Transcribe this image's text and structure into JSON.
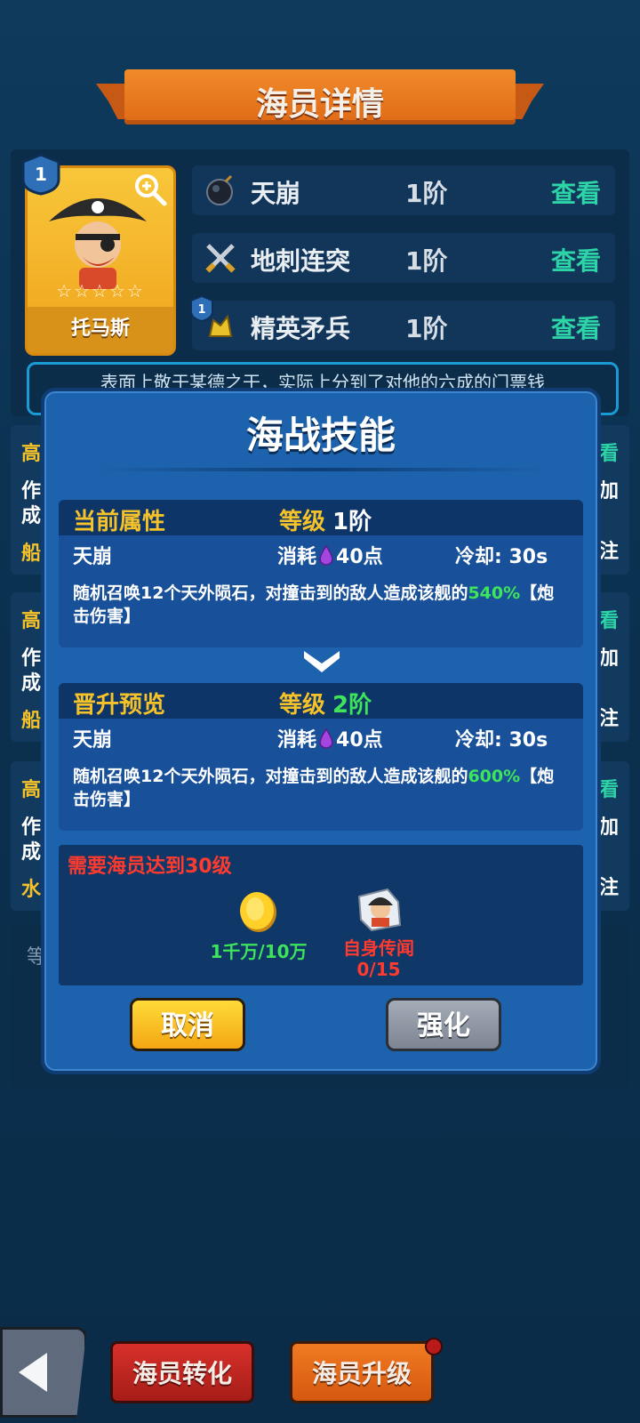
{
  "header": {
    "title": "海员详情"
  },
  "hero": {
    "level": "1",
    "name": "托马斯",
    "stars": "☆☆☆☆☆",
    "description": "表面上敬于某德之干，实际上分到了对他的六成的门票钱"
  },
  "skills": [
    {
      "name": "天崩",
      "level": "1阶",
      "action": "查看",
      "icon": "bomb-icon"
    },
    {
      "name": "地刺连突",
      "level": "1阶",
      "action": "查看",
      "icon": "crossed-swords-icon"
    },
    {
      "name": "精英矛兵",
      "level": "1阶",
      "action": "查看",
      "icon": "soldier-icon",
      "badge": "1"
    }
  ],
  "background_rows": [
    {
      "left1": "高",
      "left2": "作",
      "left3": "成",
      "left4": "船",
      "right1": "看",
      "right2": "加",
      "right3": "注"
    },
    {
      "left1": "高",
      "left2": "作",
      "left3": "成",
      "left4": "船",
      "right1": "看",
      "right2": "加",
      "right3": "注"
    },
    {
      "left1": "高",
      "left2": "作",
      "left3": "成",
      "left4": "水",
      "right1": "看",
      "right2": "加",
      "right3": "注"
    }
  ],
  "background_lower": {
    "label": "等"
  },
  "modal": {
    "title": "海战技能",
    "current": {
      "section_label": "当前属性",
      "grade_label": "等级",
      "grade_value": "1阶",
      "skill_name": "天崩",
      "cost_label": "消耗",
      "cost_value": "40点",
      "cooldown": "冷却: 30s",
      "desc_prefix": "随机召唤12个天外陨石，对撞击到的敌人造成该舰的",
      "desc_percent": "540%",
      "desc_suffix": "【炮击伤害】"
    },
    "preview": {
      "section_label": "晋升预览",
      "grade_label": "等级",
      "grade_value": "2阶",
      "skill_name": "天崩",
      "cost_label": "消耗",
      "cost_value": "40点",
      "cooldown": "冷却: 30s",
      "desc_prefix": "随机召唤12个天外陨石，对撞击到的敌人造成该舰的",
      "desc_percent": "600%",
      "desc_suffix": "【炮击伤害】"
    },
    "requirement": {
      "text": "需要海员达到30级",
      "coin_amount": "1千万/10万",
      "fragment_label": "自身传闻",
      "fragment_count": "0/15"
    },
    "cancel_label": "取消",
    "enhance_label": "强化"
  },
  "bottom": {
    "convert_label": "海员转化",
    "upgrade_label": "海员升级"
  },
  "colors": {
    "accent_green": "#3ee45a",
    "warning_red": "#ff3a2e",
    "gold": "#f6c22a",
    "teal": "#2dd4a8"
  }
}
